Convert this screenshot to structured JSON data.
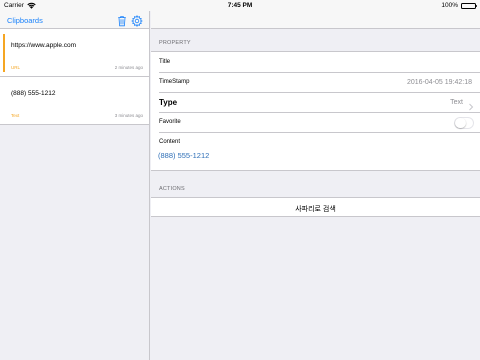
{
  "status_bar": {
    "carrier": "Carrier",
    "time": "7:45 PM",
    "battery": "100%"
  },
  "sidebar": {
    "title": "Clipboards",
    "items": [
      {
        "text": "https://www.apple.com",
        "type": "URL",
        "time_ago": "2 minutes ago",
        "selected": true
      },
      {
        "text": "(888) 555-1212",
        "type": "Text",
        "time_ago": "3 minutes ago",
        "selected": false
      }
    ]
  },
  "detail": {
    "property_header": "PROPERTY",
    "title_label": "Title",
    "title_value": "",
    "timestamp_label": "TimeStamp",
    "timestamp_value": "2016-04-05 19:42:18",
    "type_label": "Type",
    "type_value": "Text",
    "favorite_label": "Favorite",
    "favorite_on": false,
    "content_label": "Content",
    "content_value": "(888) 555-1212",
    "actions_header": "ACTIONS",
    "action_label": "사파리로 검색"
  },
  "colors": {
    "accent": "#1a82fb",
    "type_label": "#f5a623",
    "selection_bar": "#f5a623",
    "content_link": "#2e6fb7"
  },
  "icons": [
    "wifi-icon",
    "battery-icon",
    "trash-icon",
    "gear-icon",
    "chevron-right-icon"
  ]
}
